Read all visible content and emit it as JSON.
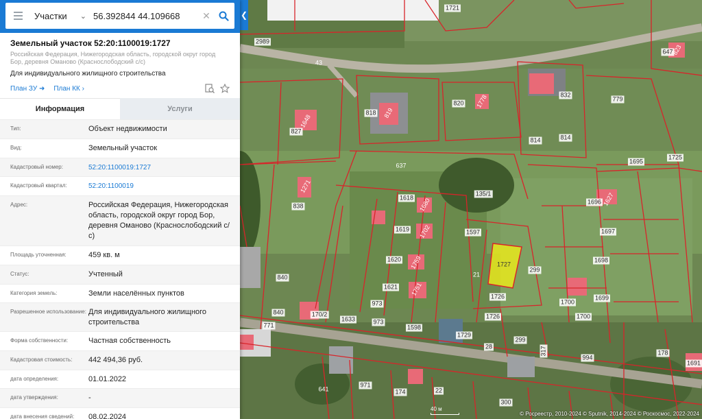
{
  "search": {
    "type_label": "Участки",
    "query": "56.392844 44.109668"
  },
  "object": {
    "title": "Земельный участок 52:20:1100019:1727",
    "region": "Российская Федерация, Нижегородская область, городской округ город Бор, деревня Оманово (Краснослободский с/с)",
    "purpose": "Для индивидуального жилищного строительства",
    "plan_zu": "План ЗУ",
    "plan_kk": "План КК"
  },
  "tabs": [
    "Информация",
    "Услуги"
  ],
  "info_rows": [
    {
      "label": "Тип:",
      "value": "Объект недвижимости"
    },
    {
      "label": "Вид:",
      "value": "Земельный участок"
    },
    {
      "label": "Кадастровый номер:",
      "value": "52:20:1100019:1727"
    },
    {
      "label": "Кадастровый квартал:",
      "value": "52:20:1100019"
    },
    {
      "label": "Адрес:",
      "value": "Российская Федерация, Нижегородская область, городской округ город Бор, деревня Оманово (Краснослободский с/с)"
    },
    {
      "label": "Площадь уточненная:",
      "value": "459 кв. м"
    },
    {
      "label": "Статус:",
      "value": "Учтенный"
    },
    {
      "label": "Категория земель:",
      "value": "Земли населённых пунктов"
    },
    {
      "label": "Разрешенное использование:",
      "value": "Для индивидуального жилищного строительства"
    },
    {
      "label": "Форма собственности:",
      "value": "Частная собственность"
    },
    {
      "label": "Кадастровая стоимость:",
      "value": "442 494,36 руб."
    },
    {
      "label": "дата определения:",
      "value": "01.01.2022"
    },
    {
      "label": "дата утверждения:",
      "value": "-"
    },
    {
      "label": "дата внесения сведений:",
      "value": "08.02.2024"
    }
  ],
  "map": {
    "parcel_labels": [
      "1721",
      "2989",
      "43",
      "647",
      "823",
      "818",
      "819",
      "820",
      "1778",
      "832",
      "779",
      "827",
      "1648",
      "814",
      "814",
      "1695",
      "1725",
      "637",
      "1618",
      "1680",
      "135/1",
      "1696",
      "1627",
      "838",
      "1271",
      "1619",
      "1702",
      "1597",
      "1697",
      "1620",
      "1759",
      "1727",
      "299",
      "1698",
      "840",
      "1621",
      "1751",
      "21",
      "1726",
      "1700",
      "1699",
      "973",
      "1726",
      "1633",
      "170/2",
      "840",
      "771",
      "1598",
      "1729",
      "1700",
      "973",
      "28",
      "299",
      "317",
      "994",
      "178",
      "1691",
      "641",
      "971",
      "174",
      "22",
      "300"
    ],
    "scale_label": "40 м",
    "copyright": "© Росреестр, 2010-2024 © Sputnik, 2014-2024 © Роскосмос, 2022-2024"
  },
  "colors": {
    "accent": "#1a7ad4",
    "parcel_line": "#d8242a",
    "selected_fill": "#e8e81c"
  },
  "icons": [
    "menu-icon",
    "chevron-down-icon",
    "clear-icon",
    "search-icon",
    "chevron-left-icon",
    "plan-zoom-icon",
    "star-icon"
  ]
}
